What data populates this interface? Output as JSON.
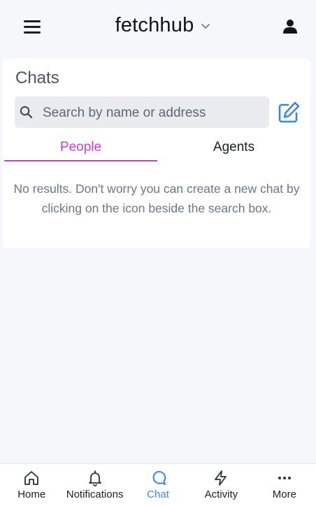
{
  "header": {
    "brand": "fetchhub"
  },
  "chats": {
    "title": "Chats",
    "search_placeholder": "Search by name or address",
    "tabs": [
      {
        "label": "People",
        "active": true
      },
      {
        "label": "Agents",
        "active": false
      }
    ],
    "empty_message": "No results. Don't worry you can create a new chat by clicking on the icon beside the search box."
  },
  "bottom_nav": {
    "items": [
      {
        "label": "Home",
        "icon": "home-icon"
      },
      {
        "label": "Notifications",
        "icon": "bell-icon"
      },
      {
        "label": "Chat",
        "icon": "chat-icon",
        "active": true
      },
      {
        "label": "Activity",
        "icon": "lightning-icon"
      },
      {
        "label": "More",
        "icon": "more-icon"
      }
    ]
  },
  "colors": {
    "accent_tab": "#c841d0",
    "active_nav": "#3d84df",
    "compose_icon": "#3d84df"
  }
}
